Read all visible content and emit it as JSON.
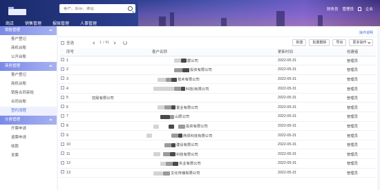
{
  "header": {
    "search_placeholder": "客户、库存、渠道",
    "nav_tabs": [
      "商店",
      "销售管理",
      "报账管理",
      "人事管理"
    ],
    "active_tab": 1,
    "user_name": "财务员",
    "user_role": "管理员",
    "user_extra": "企业"
  },
  "sidebar": {
    "groups": [
      {
        "label": "销售管理",
        "items": [
          "客户登记",
          "商机台账",
          "公开台账"
        ]
      },
      {
        "label": "商务管理",
        "items": [
          "客户登记",
          "商机台账",
          "销售合同审批",
          "合同台账",
          "签约流程"
        ]
      },
      {
        "label": "计费管理",
        "items": [
          "开票申请",
          "退票申请",
          "收款",
          "发票"
        ]
      }
    ],
    "active": "签约流程"
  },
  "main": {
    "more_link": "操作说明",
    "toolbar": {
      "select_all": "全选",
      "page": "1",
      "total": "/ 41",
      "buttons": [
        "新建",
        "批量删除",
        "导出",
        "更多操作"
      ]
    },
    "columns": [
      "序号",
      "客户名称",
      "更新时间",
      "创建者"
    ],
    "rows": [
      {
        "no": "1",
        "name": "群公司",
        "time": "2022-05-31",
        "op": "管理员"
      },
      {
        "no": "2",
        "name": "投资有限公司",
        "time": "2022-05-31",
        "op": "管理员"
      },
      {
        "no": "3",
        "name": "技术有限公司",
        "time": "2022-05-31",
        "op": "管理员"
      },
      {
        "no": "4",
        "name": "科技(有限公司",
        "time": "2022-05-31",
        "op": "管理员"
      },
      {
        "no": "5",
        "name": "控股有限公司",
        "time": "2022-05-31",
        "op": "管理员"
      },
      {
        "no": "6",
        "name": "置业有限公司",
        "time": "2022-05-31",
        "op": "管理员"
      },
      {
        "no": "7",
        "name": "山限公司",
        "time": "2022-05-31",
        "op": "管理员"
      },
      {
        "no": "8",
        "name": "投资有限公司",
        "time": "2022-05-31",
        "op": "管理员"
      },
      {
        "no": "9",
        "name": "商贸科技有限公司",
        "time": "2022-05-31",
        "op": "管理员"
      },
      {
        "no": "10",
        "name": "建设有限公司",
        "time": "2022-05-31",
        "op": "管理员"
      },
      {
        "no": "11",
        "name": "科技有限公司",
        "time": "2022-05-31",
        "op": "管理员"
      },
      {
        "no": "12",
        "name": "实业有限公司",
        "time": "2022-05-31",
        "op": "管理员"
      },
      {
        "no": "13",
        "name": "文化传播有限公司",
        "time": "2022-05-31",
        "op": "管理员"
      }
    ]
  }
}
